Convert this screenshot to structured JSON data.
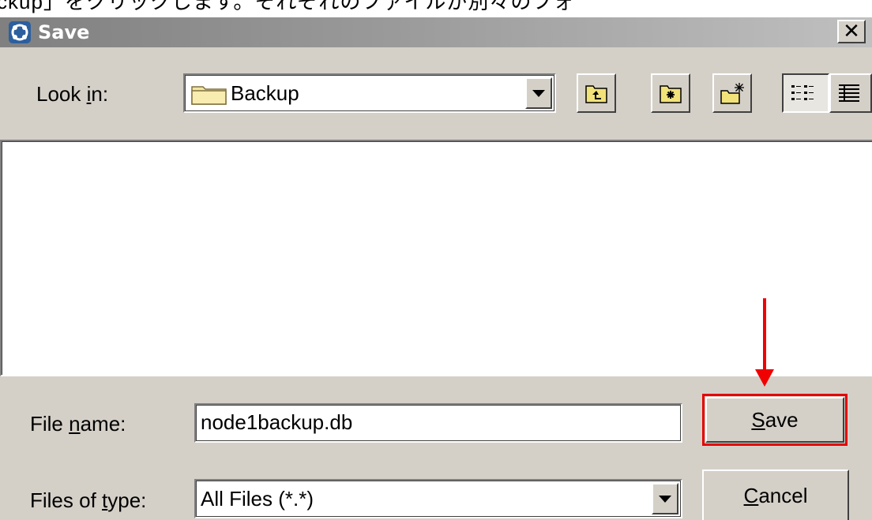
{
  "caption": {
    "text": "ckup」をクリックします。それぞれのファイルが別々のフォ"
  },
  "dialog": {
    "title": "Save",
    "close_glyph": "✕"
  },
  "look_in": {
    "label_pre": "Look ",
    "label_mnemonic": "i",
    "label_post": "n:",
    "value": "Backup",
    "folder_icon": "folder-icon"
  },
  "toolbar": {
    "icons": [
      "up-one-level-icon",
      "home-folder-icon",
      "create-new-folder-icon",
      "list-view-icon",
      "details-view-icon"
    ]
  },
  "file_name": {
    "label_pre": "File ",
    "label_mnemonic": "n",
    "label_post": "ame:",
    "value": "node1backup.db"
  },
  "file_type": {
    "label_pre": "Files of ",
    "label_mnemonic": "t",
    "label_post": "ype:",
    "value": "All Files (*.*)"
  },
  "buttons": {
    "save_mnemonic": "S",
    "save_rest": "ave",
    "cancel_mnemonic": "C",
    "cancel_rest": "ancel"
  },
  "colors": {
    "dialog_bg": "#d4d0c8",
    "annotation": "#e60000"
  }
}
